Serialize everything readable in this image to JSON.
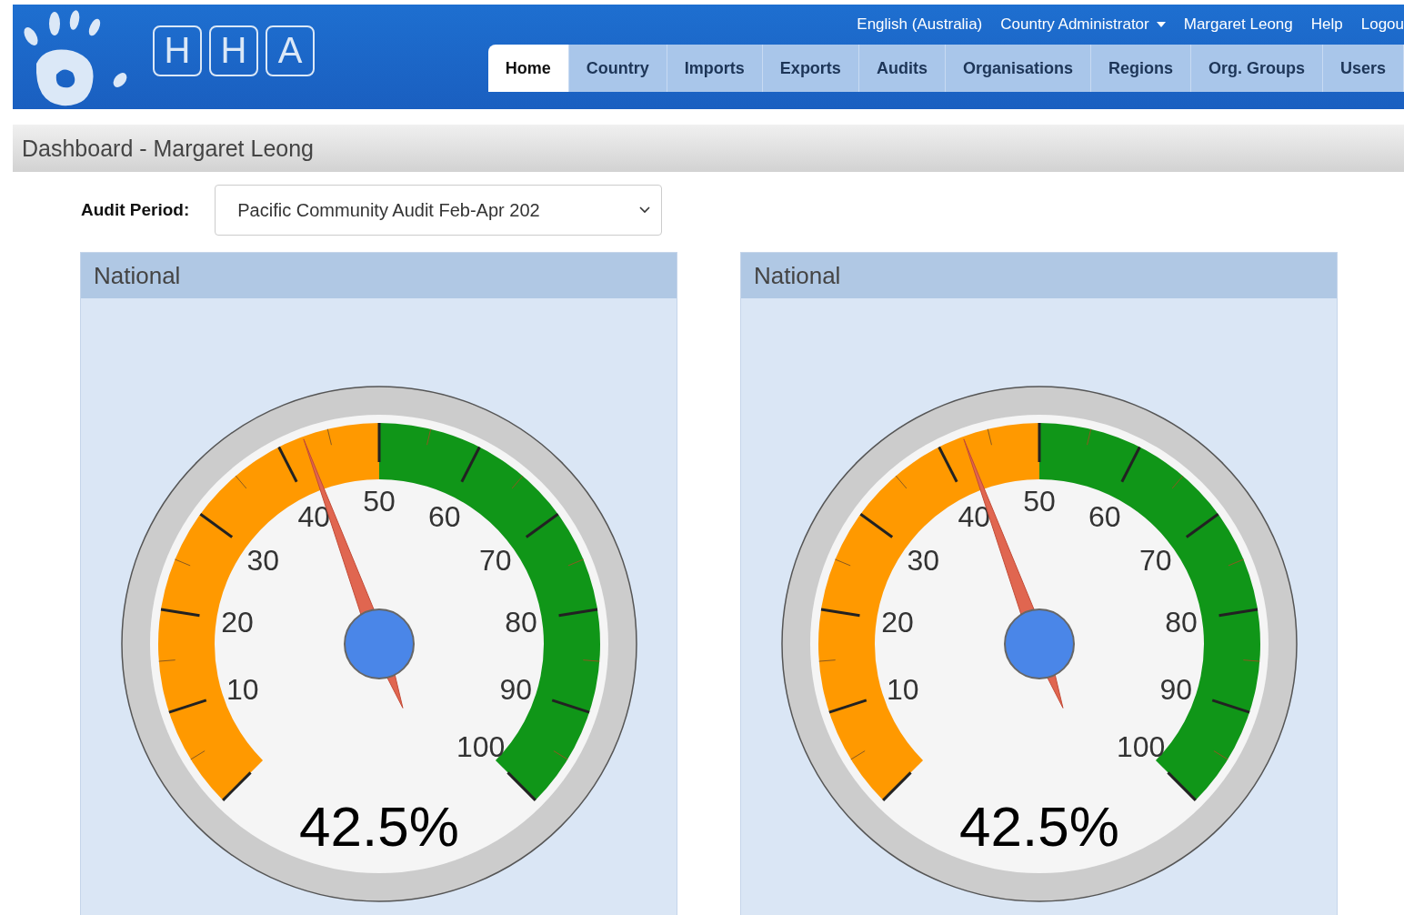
{
  "logo": {
    "letters": [
      "H",
      "H",
      "A"
    ]
  },
  "top_links": [
    {
      "label": "English (Australia)",
      "dropdown": false
    },
    {
      "label": "Country Administrator",
      "dropdown": true
    },
    {
      "label": "Margaret Leong",
      "dropdown": false
    },
    {
      "label": "Help",
      "dropdown": false
    },
    {
      "label": "Logou",
      "dropdown": false
    }
  ],
  "tabs": [
    {
      "label": "Home",
      "selected": true
    },
    {
      "label": "Country",
      "selected": false
    },
    {
      "label": "Imports",
      "selected": false
    },
    {
      "label": "Exports",
      "selected": false
    },
    {
      "label": "Audits",
      "selected": false
    },
    {
      "label": "Organisations",
      "selected": false
    },
    {
      "label": "Regions",
      "selected": false
    },
    {
      "label": "Org. Groups",
      "selected": false
    },
    {
      "label": "Users",
      "selected": false
    }
  ],
  "page_title": "Dashboard - Margaret Leong",
  "audit_period": {
    "label": "Audit Period:",
    "value": "Pacific Community Audit Feb-Apr 202"
  },
  "panels": [
    {
      "title": "National",
      "gauge": {
        "level": 0.425,
        "reading": "42.5%",
        "scale": [
          "10",
          "20",
          "30",
          "40",
          "50",
          "60",
          "70",
          "80",
          "90",
          "100"
        ]
      }
    },
    {
      "title": "National",
      "gauge": {
        "level": 0.425,
        "reading": "42.5%",
        "scale": [
          "10",
          "20",
          "30",
          "40",
          "50",
          "60",
          "70",
          "80",
          "90",
          "100"
        ]
      }
    }
  ]
}
